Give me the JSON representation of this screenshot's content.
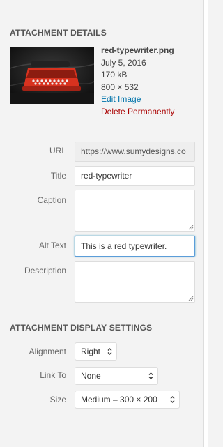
{
  "details": {
    "heading": "ATTACHMENT DETAILS",
    "filename": "red-typewriter.png",
    "date": "July 5, 2016",
    "size": "170 kB",
    "dimensions": "800 × 532",
    "edit_link": "Edit Image",
    "delete_link": "Delete Permanently"
  },
  "fields": {
    "url_label": "URL",
    "url_value": "https://www.sumydesigns.co",
    "title_label": "Title",
    "title_value": "red-typewriter",
    "caption_label": "Caption",
    "caption_value": "",
    "alt_label": "Alt Text",
    "alt_value": "This is a red typewriter.",
    "description_label": "Description",
    "description_value": ""
  },
  "display": {
    "heading": "ATTACHMENT DISPLAY SETTINGS",
    "alignment_label": "Alignment",
    "alignment_value": "Right",
    "linkto_label": "Link To",
    "linkto_value": "None",
    "size_label": "Size",
    "size_value": "Medium – 300 × 200"
  },
  "icons": {
    "select_arrow": "up-down-chevron-icon",
    "resize": "resize-grip-icon"
  },
  "colors": {
    "link": "#0073aa",
    "delete": "#a00000",
    "focus": "#5b9dd9"
  }
}
